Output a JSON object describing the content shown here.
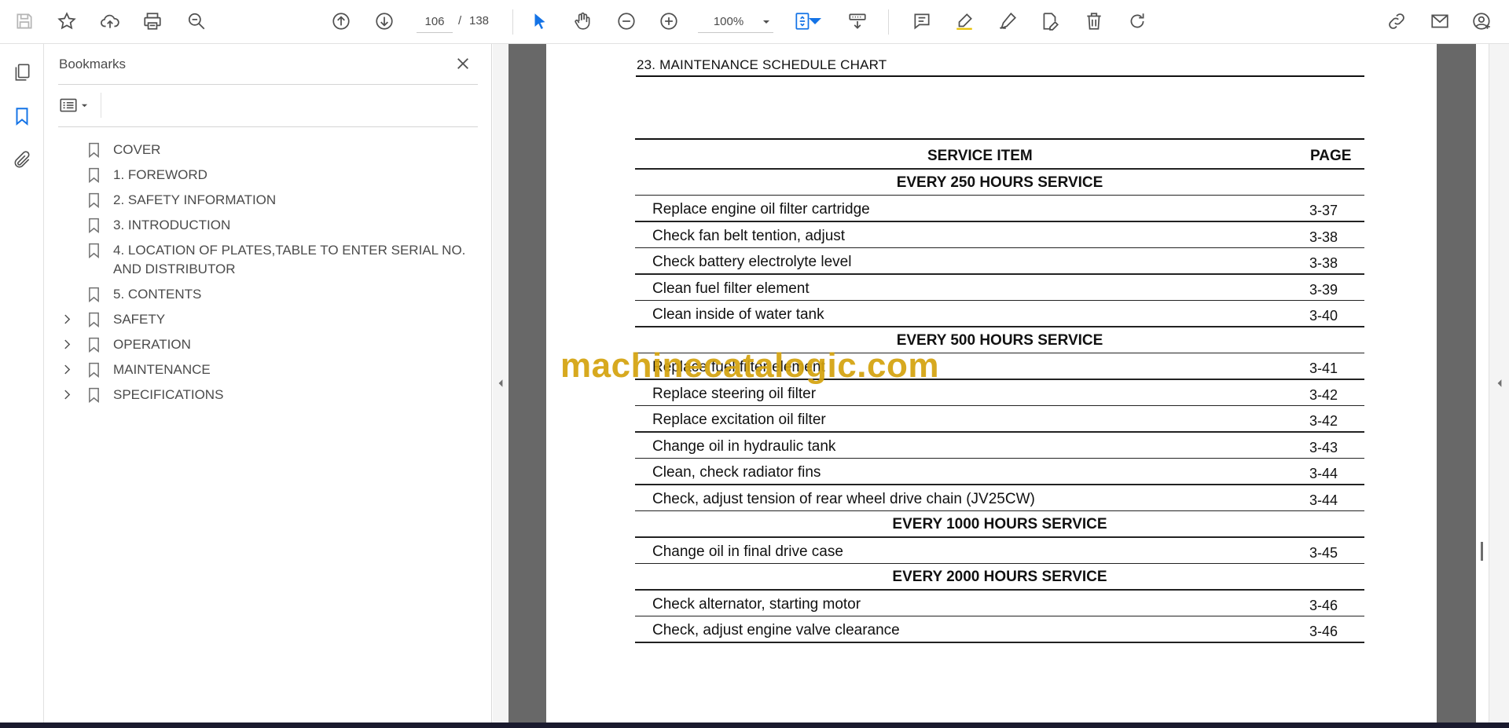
{
  "toolbar": {
    "current_page": "106",
    "page_separator": "/",
    "total_pages": "138",
    "zoom": "100%"
  },
  "bookmarks_panel": {
    "title": "Bookmarks",
    "items": [
      {
        "label": "COVER",
        "expandable": false
      },
      {
        "label": "1. FOREWORD",
        "expandable": false
      },
      {
        "label": "2. SAFETY INFORMATION",
        "expandable": false
      },
      {
        "label": "3. INTRODUCTION",
        "expandable": false
      },
      {
        "label": "4. LOCATION OF PLATES,TABLE TO ENTER SERIAL NO. AND DISTRIBUTOR",
        "expandable": false
      },
      {
        "label": "5. CONTENTS",
        "expandable": false
      },
      {
        "label": "SAFETY",
        "expandable": true
      },
      {
        "label": "OPERATION",
        "expandable": true
      },
      {
        "label": "MAINTENANCE",
        "expandable": true
      },
      {
        "label": "SPECIFICATIONS",
        "expandable": true
      }
    ]
  },
  "document": {
    "heading": "23. MAINTENANCE SCHEDULE CHART",
    "table": {
      "col_item": "SERVICE ITEM",
      "col_page": "PAGE",
      "sections": [
        {
          "title": "EVERY 250 HOURS SERVICE",
          "rows": [
            {
              "item": "Replace engine oil filter cartridge",
              "page": "3-37"
            },
            {
              "item": "Check fan belt tention, adjust",
              "page": "3-38"
            },
            {
              "item": "Check battery electrolyte level",
              "page": "3-38"
            },
            {
              "item": "Clean fuel filter element",
              "page": "3-39"
            },
            {
              "item": "Clean inside of water tank",
              "page": "3-40"
            }
          ]
        },
        {
          "title": "EVERY 500 HOURS SERVICE",
          "rows": [
            {
              "item": "Replace fuel filter element",
              "page": "3-41"
            },
            {
              "item": "Replace steering oil filter",
              "page": "3-42"
            },
            {
              "item": "Replace excitation oil filter",
              "page": "3-42"
            },
            {
              "item": "Change oil in hydraulic tank",
              "page": "3-43"
            },
            {
              "item": "Clean, check radiator fins",
              "page": "3-44"
            },
            {
              "item": "Check, adjust tension of rear wheel drive chain (JV25CW)",
              "page": "3-44"
            }
          ]
        },
        {
          "title": "EVERY 1000 HOURS SERVICE",
          "rows": [
            {
              "item": "Change oil in final drive case",
              "page": "3-45"
            }
          ]
        },
        {
          "title": "EVERY 2000 HOURS SERVICE",
          "rows": [
            {
              "item": "Check alternator, starting motor",
              "page": "3-46"
            },
            {
              "item": "Check, adjust engine valve clearance",
              "page": "3-46"
            }
          ]
        }
      ]
    },
    "watermark": "machinecatalogic.com"
  },
  "colors": {
    "accent_blue": "#1473e6",
    "icon_gray": "#505050",
    "watermark_gold": "#d4a30f"
  }
}
